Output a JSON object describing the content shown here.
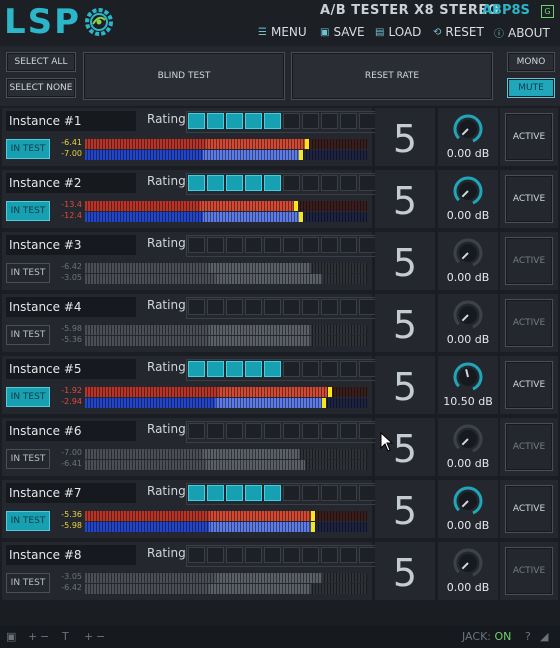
{
  "header": {
    "logo": "LSP",
    "title": "A/B TESTER X8 STEREO",
    "plugin_code": "ABP8S",
    "gicon": "G",
    "menu": [
      {
        "label": "MENU",
        "icon": "menu-icon",
        "glyph": "☰"
      },
      {
        "label": "SAVE",
        "icon": "save-icon",
        "glyph": "▣"
      },
      {
        "label": "LOAD",
        "icon": "load-icon",
        "glyph": "▤"
      },
      {
        "label": "RESET",
        "icon": "reset-icon",
        "glyph": "⟲"
      },
      {
        "label": "ABOUT",
        "icon": "about-icon",
        "glyph": "ⓘ"
      }
    ]
  },
  "controls": {
    "select_all": "SELECT ALL",
    "select_none": "SELECT NONE",
    "blind_test": "BLIND TEST",
    "reset_rate": "RESET RATE",
    "mono": "MONO",
    "mute": "MUTE"
  },
  "colors": {
    "accent": "#17a0b2",
    "meter_red": "#b7342a",
    "meter_blue": "#2445c8",
    "peak_yellow": "#f4e81c"
  },
  "rating_label": "Rating",
  "instances": [
    {
      "name": "Instance #1",
      "in_test": "IN TEST",
      "test_on": true,
      "rating_on": 5,
      "v1": "-6.41",
      "v2": "-7.00",
      "lvl1": 0.78,
      "lvl2": 0.76,
      "active": true,
      "score": "5",
      "gain": "0.00 dB",
      "knob": 0.0
    },
    {
      "name": "Instance #2",
      "in_test": "IN TEST",
      "test_on": true,
      "rating_on": 5,
      "v1": "-13.4",
      "v2": "-12.4",
      "lvl1": 0.74,
      "lvl2": 0.76,
      "active": true,
      "score": "5",
      "gain": "0.00 dB",
      "knob": 0.0
    },
    {
      "name": "Instance #3",
      "in_test": "IN TEST",
      "test_on": false,
      "rating_on": 0,
      "v1": "-6.42",
      "v2": "-3.05",
      "lvl1": 0.8,
      "lvl2": 0.84,
      "active": false,
      "score": "5",
      "gain": "0.00 dB",
      "knob": 0.0
    },
    {
      "name": "Instance #4",
      "in_test": "IN TEST",
      "test_on": false,
      "rating_on": 0,
      "v1": "-5.98",
      "v2": "-5.36",
      "lvl1": 0.8,
      "lvl2": 0.8,
      "active": false,
      "score": "5",
      "gain": "0.00 dB",
      "knob": 0.0
    },
    {
      "name": "Instance #5",
      "in_test": "IN TEST",
      "test_on": true,
      "rating_on": 5,
      "v1": "-1.92",
      "v2": "-2.94",
      "lvl1": 0.86,
      "lvl2": 0.84,
      "active": true,
      "score": "5",
      "gain": "10.50 dB",
      "knob": 0.45
    },
    {
      "name": "Instance #6",
      "in_test": "IN TEST",
      "test_on": false,
      "rating_on": 0,
      "v1": "-7.00",
      "v2": "-6.41",
      "lvl1": 0.76,
      "lvl2": 0.78,
      "active": false,
      "score": "5",
      "gain": "0.00 dB",
      "knob": 0.0
    },
    {
      "name": "Instance #7",
      "in_test": "IN TEST",
      "test_on": true,
      "rating_on": 5,
      "v1": "-5.36",
      "v2": "-5.98",
      "lvl1": 0.8,
      "lvl2": 0.8,
      "active": true,
      "score": "5",
      "gain": "0.00 dB",
      "knob": 0.0
    },
    {
      "name": "Instance #8",
      "in_test": "IN TEST",
      "test_on": false,
      "rating_on": 0,
      "v1": "-3.05",
      "v2": "-6.42",
      "lvl1": 0.84,
      "lvl2": 0.8,
      "active": false,
      "score": "5",
      "gain": "0.00 dB",
      "knob": 0.0
    }
  ],
  "active_label": "ACTIVE",
  "footer": {
    "jack_label": "JACK:",
    "jack_state": "ON"
  }
}
